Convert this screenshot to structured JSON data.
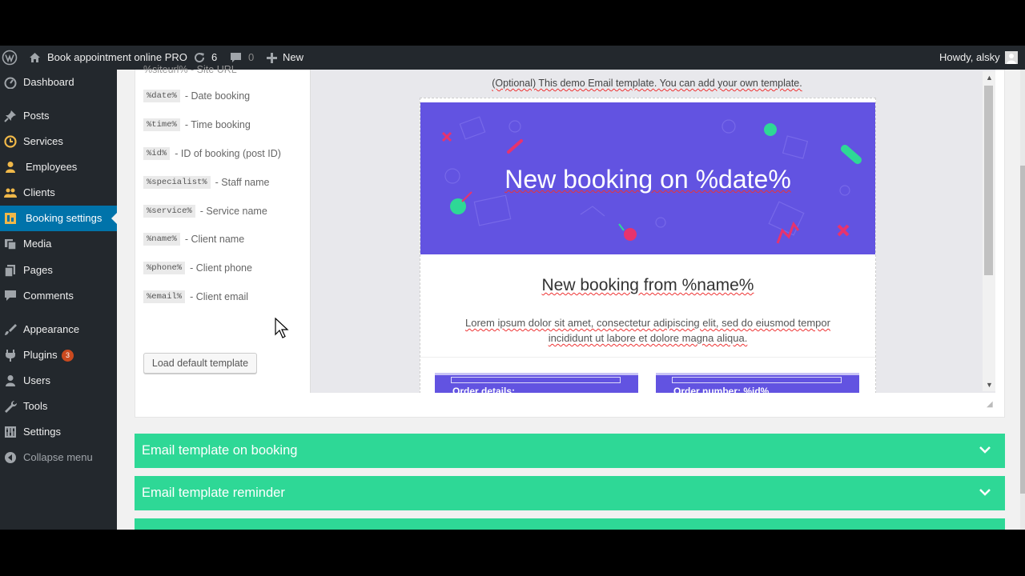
{
  "adminbar": {
    "wp_logo_icon": "wordpress-icon",
    "site_name": "Book appointment online PRO",
    "updates_count": "6",
    "comments_count": "0",
    "new_label": "New",
    "howdy": "Howdy, alsky"
  },
  "sidebar": {
    "items": [
      {
        "label": "Dashboard",
        "icon": "dashboard-icon"
      },
      {
        "label": "Posts",
        "icon": "pin-icon"
      },
      {
        "label": "Services",
        "icon": "clock-icon"
      },
      {
        "label": "Employees",
        "icon": "person-icon"
      },
      {
        "label": "Clients",
        "icon": "group-icon"
      },
      {
        "label": "Booking settings",
        "icon": "settings-grid-icon",
        "active": true
      },
      {
        "label": "Media",
        "icon": "media-icon"
      },
      {
        "label": "Pages",
        "icon": "pages-icon"
      },
      {
        "label": "Comments",
        "icon": "comment-icon"
      },
      {
        "label": "Appearance",
        "icon": "brush-icon"
      },
      {
        "label": "Plugins",
        "icon": "plug-icon",
        "badge": "3"
      },
      {
        "label": "Users",
        "icon": "user-icon"
      },
      {
        "label": "Tools",
        "icon": "wrench-icon"
      },
      {
        "label": "Settings",
        "icon": "sliders-icon"
      },
      {
        "label": "Collapse menu",
        "icon": "collapse-icon"
      }
    ]
  },
  "variables": {
    "partial_top": "%siteurl% - Site URL",
    "items": [
      {
        "code": "%date%",
        "desc": "- Date booking"
      },
      {
        "code": "%time%",
        "desc": "- Time booking"
      },
      {
        "code": "%id%",
        "desc": "- ID of booking (post ID)"
      },
      {
        "code": "%specialist%",
        "desc": "- Staff name"
      },
      {
        "code": "%service%",
        "desc": "- Service name"
      },
      {
        "code": "%name%",
        "desc": "- Client name"
      },
      {
        "code": "%phone%",
        "desc": "- Client phone"
      },
      {
        "code": "%email%",
        "desc": "- Client email"
      }
    ],
    "load_button": "Load default template"
  },
  "preview": {
    "note": "(Optional) This demo Email template. You can add your own template.",
    "hero_title": "New booking on %date%",
    "heading": "New booking from %name%",
    "body": "Lorem ipsum dolor sit amet, consectetur adipiscing elit, sed do eiusmod tempor incididunt ut labore et dolore magna aliqua.",
    "order_details": "Order details:",
    "order_number": "Order number: %id%"
  },
  "accordions": [
    {
      "title": "Email template on booking"
    },
    {
      "title": "Email template reminder"
    }
  ],
  "colors": {
    "admin_dark": "#23282d",
    "active_blue": "#0073aa",
    "accordion_green": "#2ed896",
    "email_purple": "#6253e1"
  }
}
